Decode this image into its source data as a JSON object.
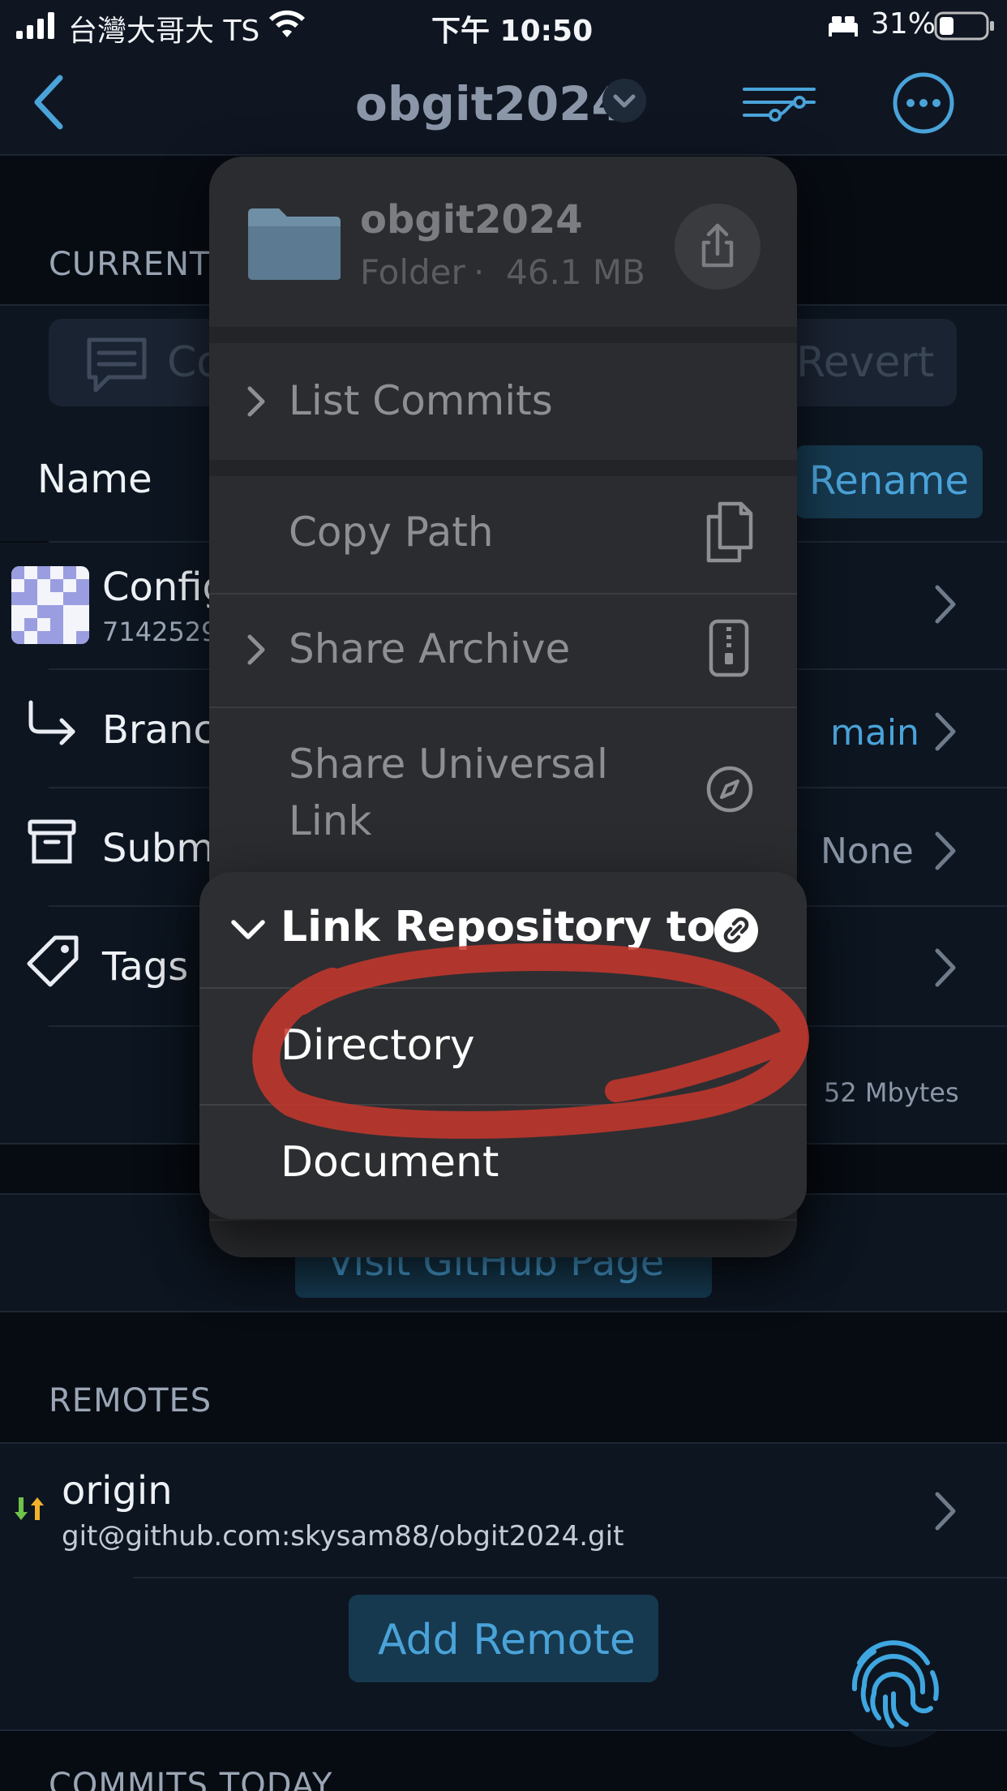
{
  "status_bar": {
    "carrier": "台灣大哥大 TS",
    "time": "下午 10:50",
    "battery": "31%"
  },
  "nav": {
    "title": "obgit2024"
  },
  "background": {
    "current_label": "CURRENT",
    "commit_placeholder": "Co",
    "revert_label": "Revert",
    "name_label": "Name",
    "rename_label": "Rename",
    "config_label": "Config",
    "config_sub": "7142529",
    "branch_label": "Branc",
    "branch_value": "main",
    "submodule_label": "Subm",
    "submodule_value": "None",
    "tags_label": "Tags",
    "size_value": "52 Mbytes",
    "github_button": "Visit GitHub Page",
    "remotes_label": "REMOTES",
    "remote_name": "origin",
    "remote_url": "git@github.com:skysam88/obgit2024.git",
    "add_remote": "Add Remote",
    "commits_today": "COMMITS TODAY"
  },
  "menu": {
    "folder_name": "obgit2024",
    "folder_type": "Folder",
    "folder_size": "46.1 MB",
    "items": [
      {
        "label": "List Commits"
      },
      {
        "label": "Copy Path"
      },
      {
        "label": "Share Archive"
      },
      {
        "label": "Share Universal Link"
      }
    ]
  },
  "submenu": {
    "header": "Link Repository to",
    "options": [
      "Directory",
      "Document"
    ]
  },
  "colors": {
    "accent": "#4aa3d9",
    "annotation_red": "#c8372d",
    "remote_arrow_up": "#f2b02b",
    "remote_arrow_down": "#6fc24a"
  }
}
